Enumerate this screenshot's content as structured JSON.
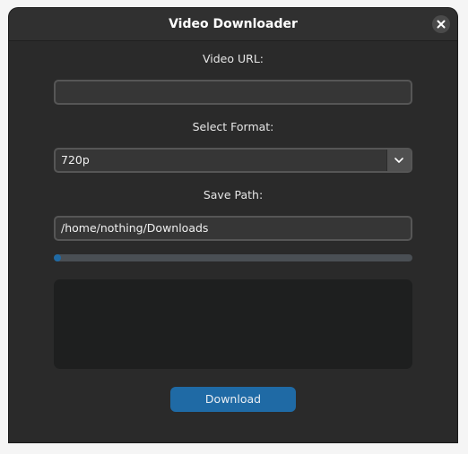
{
  "window": {
    "title": "Video Downloader"
  },
  "url": {
    "label": "Video URL:",
    "value": ""
  },
  "format": {
    "label": "Select Format:",
    "selected": "720p"
  },
  "save_path": {
    "label": "Save Path:",
    "value": "/home/nothing/Downloads"
  },
  "progress": {
    "fraction": 0.02
  },
  "log": {
    "text": ""
  },
  "actions": {
    "download_label": "Download"
  },
  "colors": {
    "accent": "#1f6aa5",
    "window_bg": "#2a2a2a",
    "field_bg": "#363636",
    "log_bg": "#1e1f1f"
  },
  "icons": {
    "close": "close-icon",
    "dropdown": "chevron-down-icon"
  }
}
